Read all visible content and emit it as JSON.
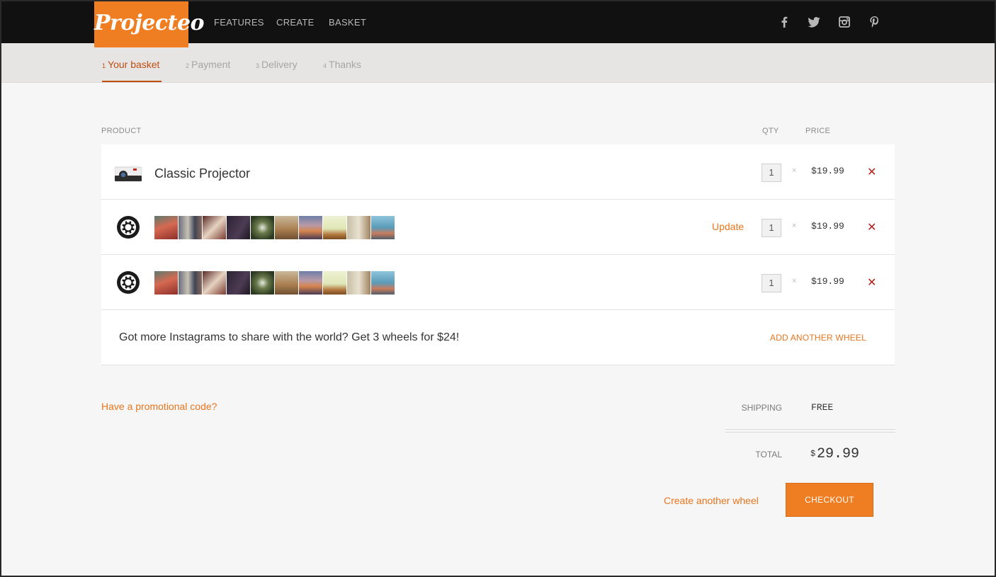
{
  "brand": {
    "logo_text": "Projecteo",
    "accent": "#ef7d22"
  },
  "nav": {
    "items": [
      "FEATURES",
      "CREATE",
      "BASKET"
    ],
    "social": [
      "facebook-icon",
      "twitter-icon",
      "instagram-icon",
      "pinterest-icon"
    ]
  },
  "steps": [
    {
      "num": "1",
      "label": "Your basket",
      "active": true
    },
    {
      "num": "2",
      "label": "Payment",
      "active": false
    },
    {
      "num": "3",
      "label": "Delivery",
      "active": false
    },
    {
      "num": "4",
      "label": "Thanks",
      "active": false
    }
  ],
  "table": {
    "headers": {
      "product": "PRODUCT",
      "qty": "QTY",
      "price": "PRICE"
    },
    "rows": [
      {
        "type": "projector",
        "name": "Classic Projector",
        "qty": "1",
        "times": "×",
        "price": "$19.99",
        "remove": "✕"
      },
      {
        "type": "wheel",
        "update_label": "Update",
        "qty": "1",
        "times": "×",
        "price": "$19.99",
        "remove": "✕"
      },
      {
        "type": "wheel",
        "qty": "1",
        "times": "×",
        "price": "$19.99",
        "remove": "✕"
      }
    ]
  },
  "promo": {
    "text": "Got more Instagrams to share with the world? Get 3 wheels for $24!",
    "action": "ADD ANOTHER WHEEL"
  },
  "promo_code_link": "Have a promotional code?",
  "summary": {
    "shipping_label": "SHIPPING",
    "shipping_value": "FREE",
    "total_label": "TOTAL",
    "total_currency": "$",
    "total_value": "29.99"
  },
  "actions": {
    "create_another": "Create another wheel",
    "checkout": "CHECKOUT"
  }
}
